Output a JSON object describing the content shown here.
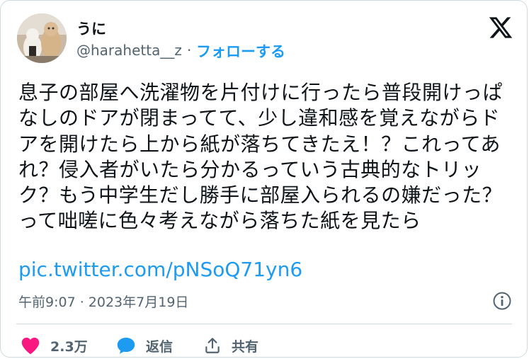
{
  "author": {
    "name": "うに",
    "handle": "@harahetta__z",
    "separator": "·",
    "follow_label": "フォローする"
  },
  "brand": {
    "logo_icon": "x-logo-icon"
  },
  "tweet": {
    "text": "息子の部屋へ洗濯物を片付けに行ったら普段開けっぱなしのドアが閉まってて、少し違和感を覚えながらドアを開けたら上から紙が落ちてきたえ！？これってあれ？侵入者がいたら分かるっていう古典的なトリック？もう中学生だし勝手に部屋入られるの嫌だった？\nって咄嗟に色々考えながら落ちた紙を見たら",
    "link": "pic.twitter.com/pNSoQ71yn6",
    "timestamp": "午前9:07 · 2023年7月19日"
  },
  "actions": {
    "like": {
      "icon": "heart-icon",
      "count": "2.3万",
      "color": "#f91880"
    },
    "reply": {
      "icon": "speech-bubble-icon",
      "label": "返信",
      "color": "#1d9bf0"
    },
    "share": {
      "icon": "share-icon",
      "label": "共有"
    }
  },
  "colors": {
    "accent": "#1d9bf0",
    "muted": "#536471",
    "like": "#f91880"
  }
}
